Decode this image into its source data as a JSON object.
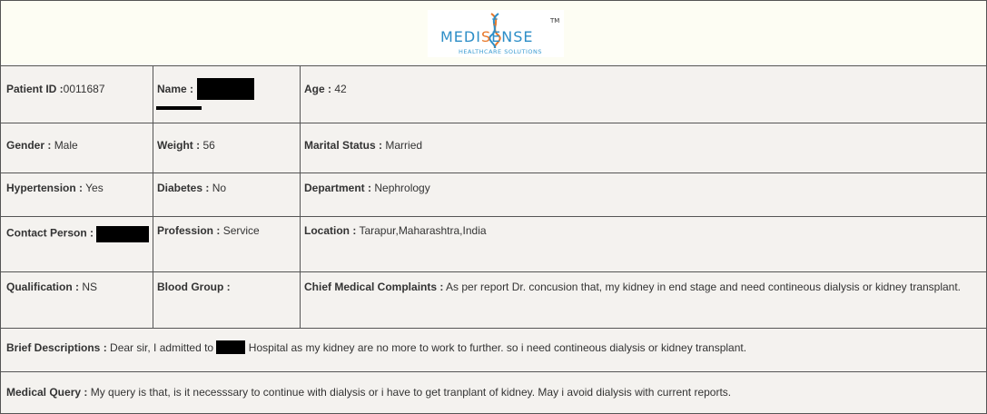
{
  "logo": {
    "brand_prefix": "MEDI",
    "brand_mark": "S",
    "brand_suffix": "ENSE",
    "trademark": "TM",
    "tagline": "HEALTHCARE SOLUTIONS"
  },
  "patient": {
    "patient_id_label": "Patient ID :",
    "patient_id": "0011687",
    "name_label": "Name :",
    "age_label": "Age :",
    "age": "42",
    "gender_label": "Gender :",
    "gender": "Male",
    "weight_label": "Weight :",
    "weight": "56",
    "marital_label": "Marital Status :",
    "marital": "Married",
    "hypertension_label": "Hypertension :",
    "hypertension": "Yes",
    "diabetes_label": "Diabetes :",
    "diabetes": "No",
    "department_label": "Department :",
    "department": "Nephrology",
    "contact_label": "Contact Person :",
    "profession_label": "Profession :",
    "profession": "Service",
    "location_label": "Location :",
    "location": "Tarapur,Maharashtra,India",
    "qualification_label": "Qualification :",
    "qualification": "NS",
    "blood_group_label": "Blood Group :",
    "blood_group": "",
    "complaints_label": "Chief Medical Complaints :",
    "complaints": "As per report Dr. concusion that, my kidney in end stage and need contineous dialysis or kidney transplant.",
    "brief_label": "Brief Descriptions :",
    "brief_before": "Dear sir, I admitted to",
    "brief_after": "Hospital as my kidney are no more to work to further. so i need contineous dialysis or kidney transplant.",
    "query_label": "Medical Query :",
    "query": "My query is that, is it necesssary to continue with dialysis or i have to get tranplant of kidney. May i avoid dialysis with current reports."
  },
  "colors": {
    "border": "#555555",
    "background": "#f4f2ef",
    "header_background": "#fdfdf3",
    "logo_blue": "#2d8ec7",
    "logo_orange": "#e8782a",
    "redaction": "#000000"
  }
}
